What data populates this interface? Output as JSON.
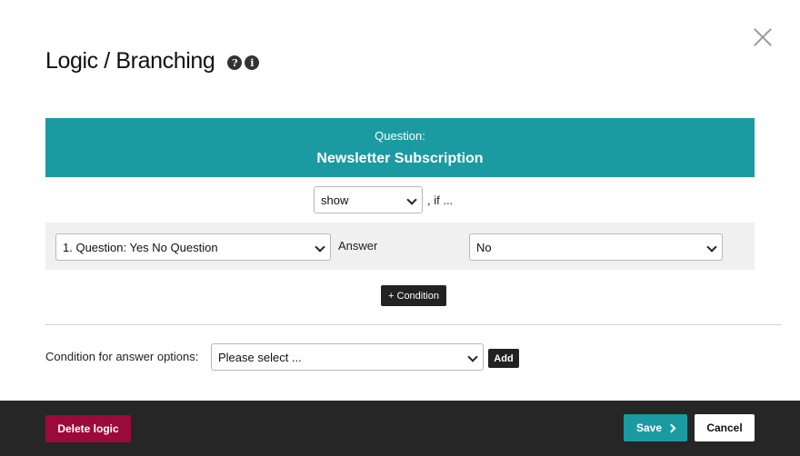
{
  "dialog": {
    "title": "Logic / Branching",
    "help_icon": "question-icon",
    "info_icon": "info-icon",
    "close_icon": "close-icon"
  },
  "question": {
    "label": "Question:",
    "title": "Newsletter Subscription",
    "banner_color": "#1b9aa2"
  },
  "visibility": {
    "selected": "show",
    "suffix": ", if ..."
  },
  "condition": {
    "question_selected": "1. Question: Yes No Question",
    "answer_label": "Answer",
    "answer_selected": "No",
    "add_condition_label": "+ Condition"
  },
  "answer_options": {
    "label": "Condition for answer options:",
    "placeholder": "Please select ...",
    "add_label": "Add"
  },
  "footer": {
    "delete_label": "Delete logic",
    "delete_color": "#9b0a3a",
    "save_label": "Save",
    "save_icon": "chevron-right-icon",
    "cancel_label": "Cancel"
  }
}
